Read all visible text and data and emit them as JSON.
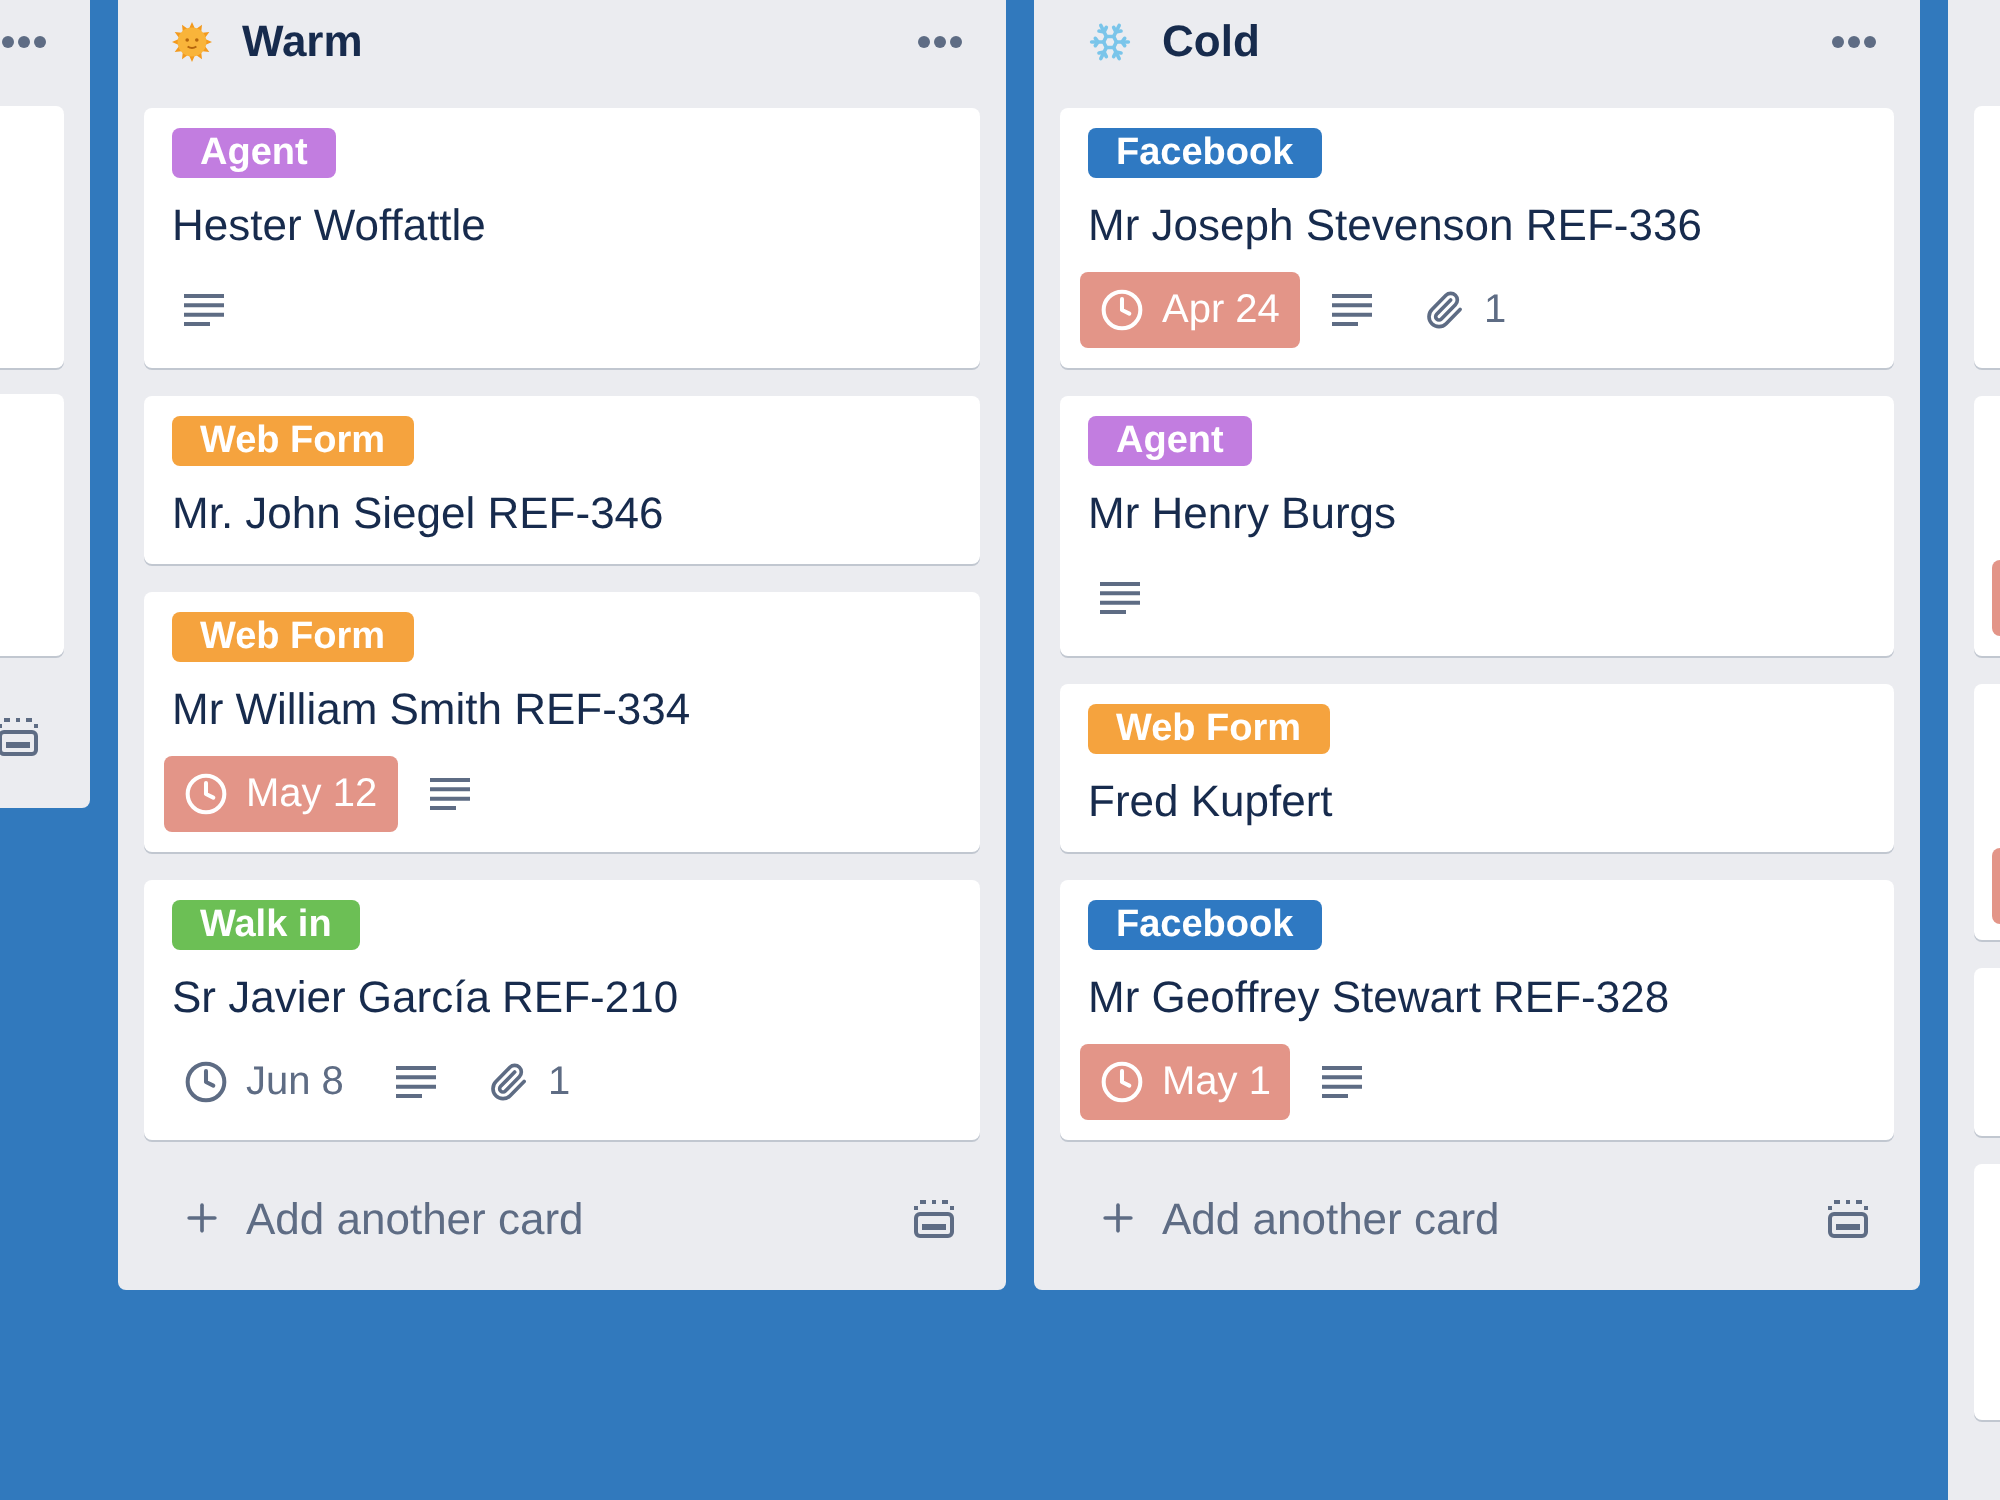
{
  "left_list_edge": {
    "cards": [
      {
        "kind": "blank"
      },
      {
        "kind": "blank"
      }
    ]
  },
  "lists": [
    {
      "title": "Warm",
      "kind": "sun",
      "cards": [
        {
          "label": {
            "text": "Agent",
            "color": "#c27de0"
          },
          "title": "Hester Woffattle",
          "badges": [
            {
              "kind": "description"
            }
          ]
        },
        {
          "label": {
            "text": "Web Form",
            "color": "#f5a33e"
          },
          "title": "Mr. John Siegel REF-346"
        },
        {
          "label": {
            "text": "Web Form",
            "color": "#f5a33e"
          },
          "title": "Mr William Smith REF-334",
          "badges": [
            {
              "kind": "due",
              "text": "May 12",
              "overdue": true
            },
            {
              "kind": "description"
            }
          ]
        },
        {
          "label": {
            "text": "Walk in",
            "color": "#6cbf55"
          },
          "title": "Sr Javier García REF-210",
          "badges": [
            {
              "kind": "due",
              "text": "Jun 8",
              "overdue": false
            },
            {
              "kind": "description"
            },
            {
              "kind": "attachments",
              "text": "1"
            }
          ]
        }
      ],
      "add_card": "Add another card"
    },
    {
      "title": "Cold",
      "kind": "snowflake",
      "cards": [
        {
          "label": {
            "text": "Facebook",
            "color": "#2f79c2"
          },
          "title": "Mr Joseph Stevenson REF-336",
          "badges": [
            {
              "kind": "due",
              "text": "Apr 24",
              "overdue": true
            },
            {
              "kind": "description"
            },
            {
              "kind": "attachments",
              "text": "1"
            }
          ]
        },
        {
          "label": {
            "text": "Agent",
            "color": "#c27de0"
          },
          "title": "Mr Henry Burgs",
          "badges": [
            {
              "kind": "description"
            }
          ]
        },
        {
          "label": {
            "text": "Web Form",
            "color": "#f5a33e"
          },
          "title": "Fred Kupfert"
        },
        {
          "label": {
            "text": "Facebook",
            "color": "#2f79c2"
          },
          "title": "Mr Geoffrey Stewart REF-328",
          "badges": [
            {
              "kind": "due",
              "text": "May 1",
              "overdue": true
            },
            {
              "kind": "description"
            }
          ]
        }
      ],
      "add_card": "Add another card"
    }
  ],
  "right_list_edge": {
    "cards": [
      {
        "due_badge": false
      },
      {
        "due_badge": true
      },
      {
        "due_badge": true
      },
      {
        "due_badge": false
      },
      {
        "due_badge": false
      }
    ]
  }
}
